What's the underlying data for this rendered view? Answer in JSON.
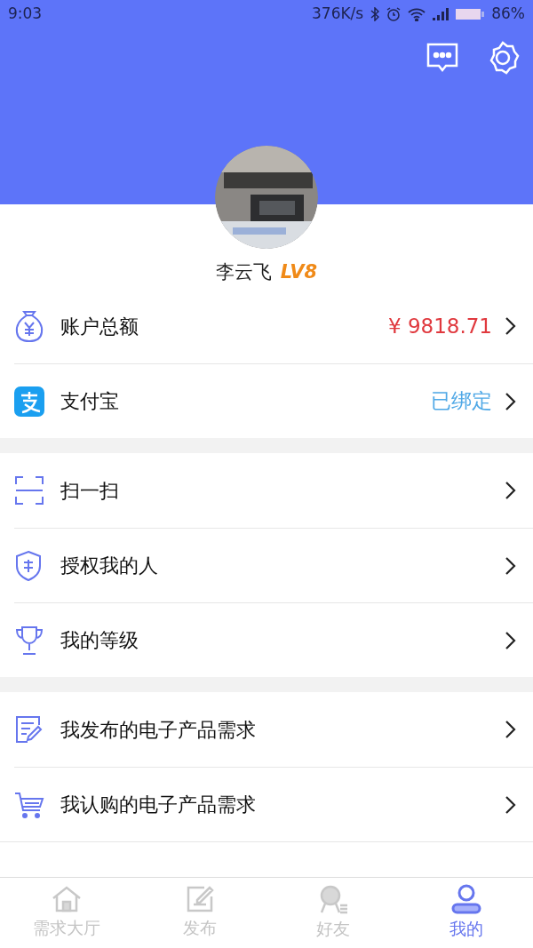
{
  "status_bar": {
    "time": "9:03",
    "speed": "376K/s",
    "battery": "86%"
  },
  "profile": {
    "name": "李云飞",
    "level": "LV8"
  },
  "groups": [
    [
      {
        "label": "账户总额",
        "kind": "amount",
        "value": "¥ 9818.71"
      },
      {
        "label": "支付宝",
        "kind": "binding",
        "value": "已绑定"
      }
    ],
    [
      {
        "label": "扫一扫"
      },
      {
        "label": "授权我的人"
      },
      {
        "label": "我的等级"
      }
    ],
    [
      {
        "label": "我发布的电子产品需求"
      },
      {
        "label": "我认购的电子产品需求"
      }
    ]
  ],
  "tabs": [
    {
      "label": "需求大厅",
      "selected": false
    },
    {
      "label": "发布",
      "selected": false
    },
    {
      "label": "好友",
      "selected": false
    },
    {
      "label": "我的",
      "selected": true
    }
  ]
}
